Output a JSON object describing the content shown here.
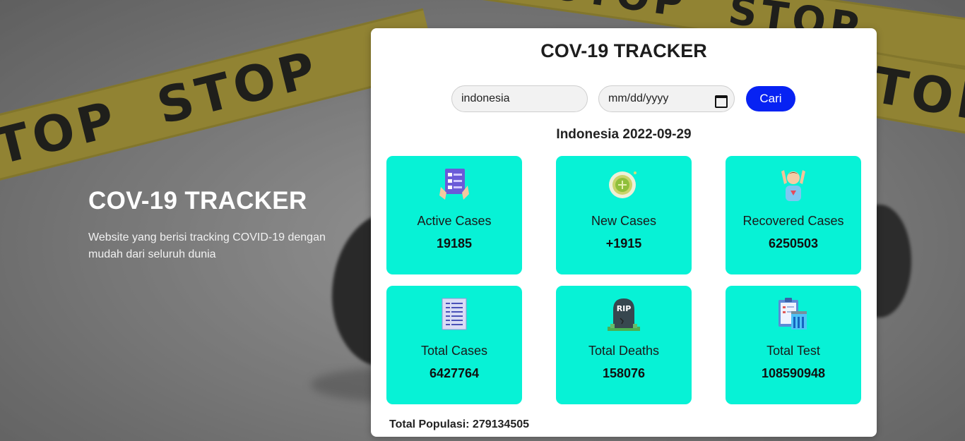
{
  "background": {
    "tape_word": "STOP"
  },
  "hero": {
    "title": "COV-19 TRACKER",
    "description": "Website yang berisi tracking COVID-19 dengan mudah dari seluruh dunia"
  },
  "panel": {
    "title": "COV-19 TRACKER",
    "search": {
      "country_value": "indonesia",
      "date_placeholder": "mm/dd/yyyy",
      "button_label": "Cari"
    },
    "location_date": "Indonesia 2022-09-29",
    "cards": [
      {
        "label": "Active Cases",
        "value": "19185",
        "icon": "checklist-icon"
      },
      {
        "label": "New Cases",
        "value": "+1915",
        "icon": "virus-icon"
      },
      {
        "label": "Recovered Cases",
        "value": "6250503",
        "icon": "recovered-person-icon"
      },
      {
        "label": "Total Cases",
        "value": "6427764",
        "icon": "report-icon"
      },
      {
        "label": "Total Deaths",
        "value": "158076",
        "icon": "tombstone-icon"
      },
      {
        "label": "Total Test",
        "value": "108590948",
        "icon": "clipboard-test-icon"
      }
    ],
    "population_text": "Total Populasi: 279134505"
  },
  "colors": {
    "card_bg": "#07f2d6",
    "button_bg": "#0722f3",
    "tape": "#c9b43a"
  }
}
